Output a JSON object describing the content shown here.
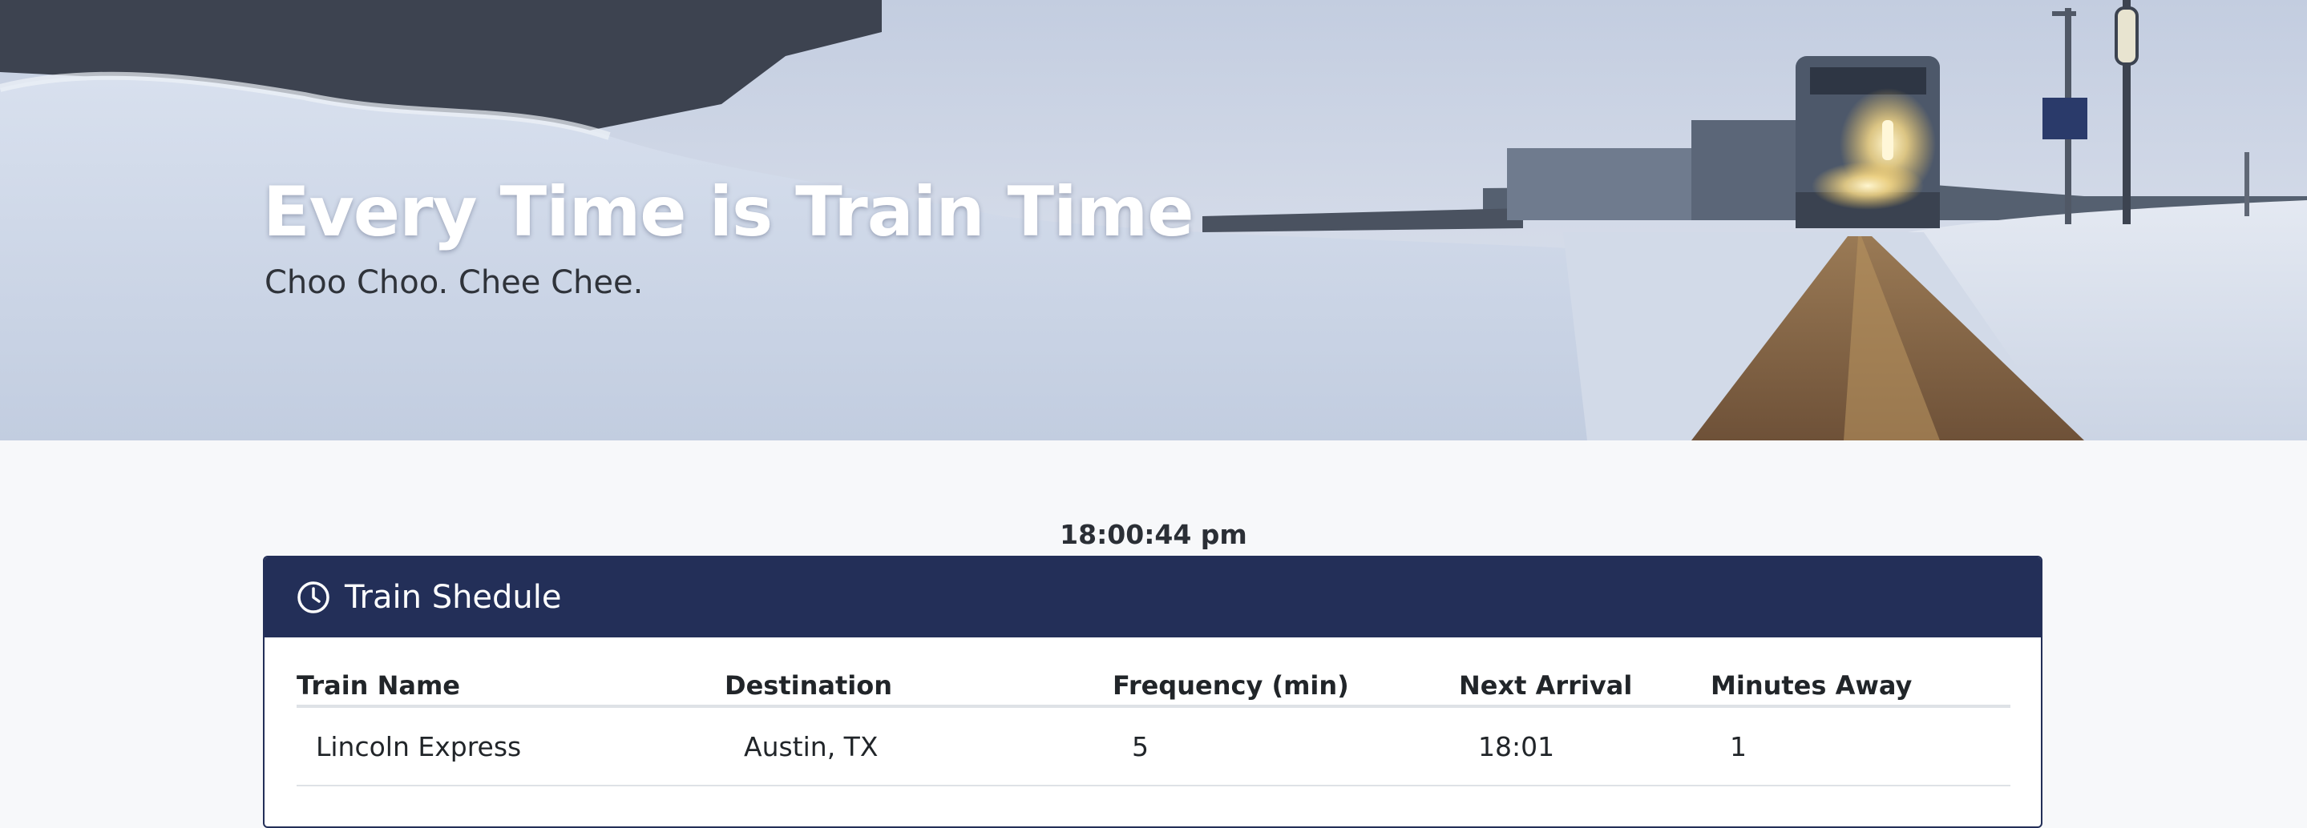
{
  "hero": {
    "title": "Every Time is Train Time",
    "subtitle": "Choo Choo. Chee Chee."
  },
  "clock": {
    "time": "18:00:44 pm"
  },
  "schedule": {
    "title": "Train Shedule",
    "header_color": "#232f58",
    "columns": [
      "Train Name",
      "Destination",
      "Frequency (min)",
      "Next Arrival",
      "Minutes Away"
    ],
    "rows": [
      {
        "name": "Lincoln Express",
        "destination": "Austin, TX",
        "frequency": "5",
        "next_arrival": "18:01",
        "minutes_away": "1"
      }
    ]
  }
}
